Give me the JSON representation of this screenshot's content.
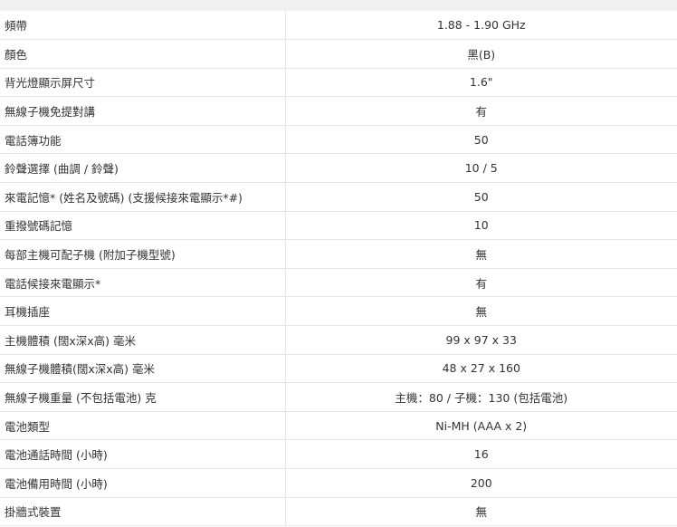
{
  "specs": [
    {
      "label": "頻帶",
      "value": "1.88 - 1.90 GHz"
    },
    {
      "label": "顏色",
      "value": "黑(B)"
    },
    {
      "label": "背光燈顯示屏尺寸",
      "value": "1.6\""
    },
    {
      "label": "無線子機免提對講",
      "value": "有"
    },
    {
      "label": "電話簿功能",
      "value": "50"
    },
    {
      "label": "鈴聲選擇 (曲調 / 鈴聲)",
      "value": "10 / 5"
    },
    {
      "label": "來電記憶* (姓名及號碼) (支援候接來電顯示*#)",
      "value": "50"
    },
    {
      "label": "重撥號碼記憶",
      "value": "10"
    },
    {
      "label": "每部主機可配子機 (附加子機型號)",
      "value": "無"
    },
    {
      "label": "電話候接來電顯示*",
      "value": "有"
    },
    {
      "label": "耳機插座",
      "value": "無"
    },
    {
      "label": "主機體積 (闊x深x高) 毫米",
      "value": "99 x 97 x 33"
    },
    {
      "label": "無線子機體積(闊x深x高) 毫米",
      "value": "48 x 27 x 160"
    },
    {
      "label": "無線子機重量 (不包括電池) 克",
      "value": "主機：80 / 子機：130 (包括電池)"
    },
    {
      "label": "電池類型",
      "value": "Ni-MH (AAA x 2)"
    },
    {
      "label": "電池通話時間 (小時)",
      "value": "16"
    },
    {
      "label": "電池備用時間 (小時)",
      "value": "200"
    },
    {
      "label": "掛牆式裝置",
      "value": "無"
    }
  ]
}
